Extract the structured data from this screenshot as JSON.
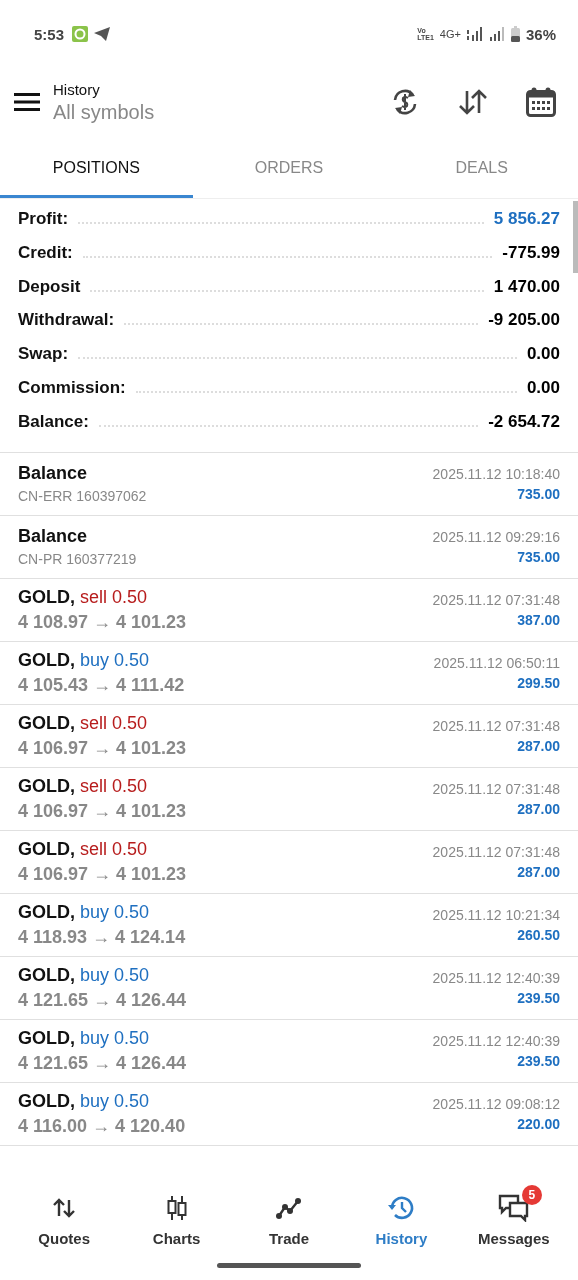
{
  "status_bar": {
    "time": "5:53",
    "volte": [
      "Vo",
      "LTE1"
    ],
    "network": "4G+",
    "battery": "36%"
  },
  "header": {
    "title": "History",
    "subtitle": "All symbols"
  },
  "tabs": [
    {
      "label": "POSITIONS",
      "selected": true
    },
    {
      "label": "ORDERS",
      "selected": false
    },
    {
      "label": "DEALS",
      "selected": false
    }
  ],
  "summary": [
    {
      "label": "Profit:",
      "value": "5 856.27",
      "color": "#1e6fc0"
    },
    {
      "label": "Credit:",
      "value": "-775.99",
      "color": "#000000"
    },
    {
      "label": "Deposit",
      "value": "1 470.00",
      "color": "#000000"
    },
    {
      "label": "Withdrawal:",
      "value": "-9 205.00",
      "color": "#000000"
    },
    {
      "label": "Swap:",
      "value": "0.00",
      "color": "#000000"
    },
    {
      "label": "Commission:",
      "value": "0.00",
      "color": "#000000"
    },
    {
      "label": "Balance:",
      "value": "-2 654.72",
      "color": "#000000"
    }
  ],
  "rows": [
    {
      "kind": "balance",
      "title": "Balance",
      "detail": "CN-ERR 160397062",
      "time": "2025.11.12 10:18:40",
      "amount": "735.00"
    },
    {
      "kind": "balance",
      "title": "Balance",
      "detail": "CN-PR 160377219",
      "time": "2025.11.12 09:29:16",
      "amount": "735.00"
    },
    {
      "kind": "trade",
      "title": "GOLD,",
      "action": "sell 0.50",
      "color": "#b71c1c",
      "detail": "4 108.97 → 4 101.23",
      "time": "2025.11.12 07:31:48",
      "amount": "387.00"
    },
    {
      "kind": "trade",
      "title": "GOLD,",
      "action": "buy 0.50",
      "color": "#1e6fc0",
      "detail": "4 105.43 → 4 111.42",
      "time": "2025.11.12 06:50:11",
      "amount": "299.50"
    },
    {
      "kind": "trade",
      "title": "GOLD,",
      "action": "sell 0.50",
      "color": "#b71c1c",
      "detail": "4 106.97 → 4 101.23",
      "time": "2025.11.12 07:31:48",
      "amount": "287.00"
    },
    {
      "kind": "trade",
      "title": "GOLD,",
      "action": "sell 0.50",
      "color": "#b71c1c",
      "detail": "4 106.97 → 4 101.23",
      "time": "2025.11.12 07:31:48",
      "amount": "287.00"
    },
    {
      "kind": "trade",
      "title": "GOLD,",
      "action": "sell 0.50",
      "color": "#b71c1c",
      "detail": "4 106.97 → 4 101.23",
      "time": "2025.11.12 07:31:48",
      "amount": "287.00"
    },
    {
      "kind": "trade",
      "title": "GOLD,",
      "action": "buy 0.50",
      "color": "#1e6fc0",
      "detail": "4 118.93 → 4 124.14",
      "time": "2025.11.12 10:21:34",
      "amount": "260.50"
    },
    {
      "kind": "trade",
      "title": "GOLD,",
      "action": "buy 0.50",
      "color": "#1e6fc0",
      "detail": "4 121.65 → 4 126.44",
      "time": "2025.11.12 12:40:39",
      "amount": "239.50"
    },
    {
      "kind": "trade",
      "title": "GOLD,",
      "action": "buy 0.50",
      "color": "#1e6fc0",
      "detail": "4 121.65 → 4 126.44",
      "time": "2025.11.12 12:40:39",
      "amount": "239.50"
    },
    {
      "kind": "trade",
      "title": "GOLD,",
      "action": "buy 0.50",
      "color": "#1e6fc0",
      "detail": "4 116.00 → 4 120.40",
      "time": "2025.11.12 09:08:12",
      "amount": "220.00"
    }
  ],
  "nav": [
    {
      "kind": "quotes",
      "label": "Quotes",
      "selected": false
    },
    {
      "kind": "charts",
      "label": "Charts",
      "selected": false
    },
    {
      "kind": "trade",
      "label": "Trade",
      "selected": false
    },
    {
      "kind": "history",
      "label": "History",
      "selected": true
    },
    {
      "kind": "messages",
      "label": "Messages",
      "selected": false,
      "badge": "5"
    }
  ]
}
